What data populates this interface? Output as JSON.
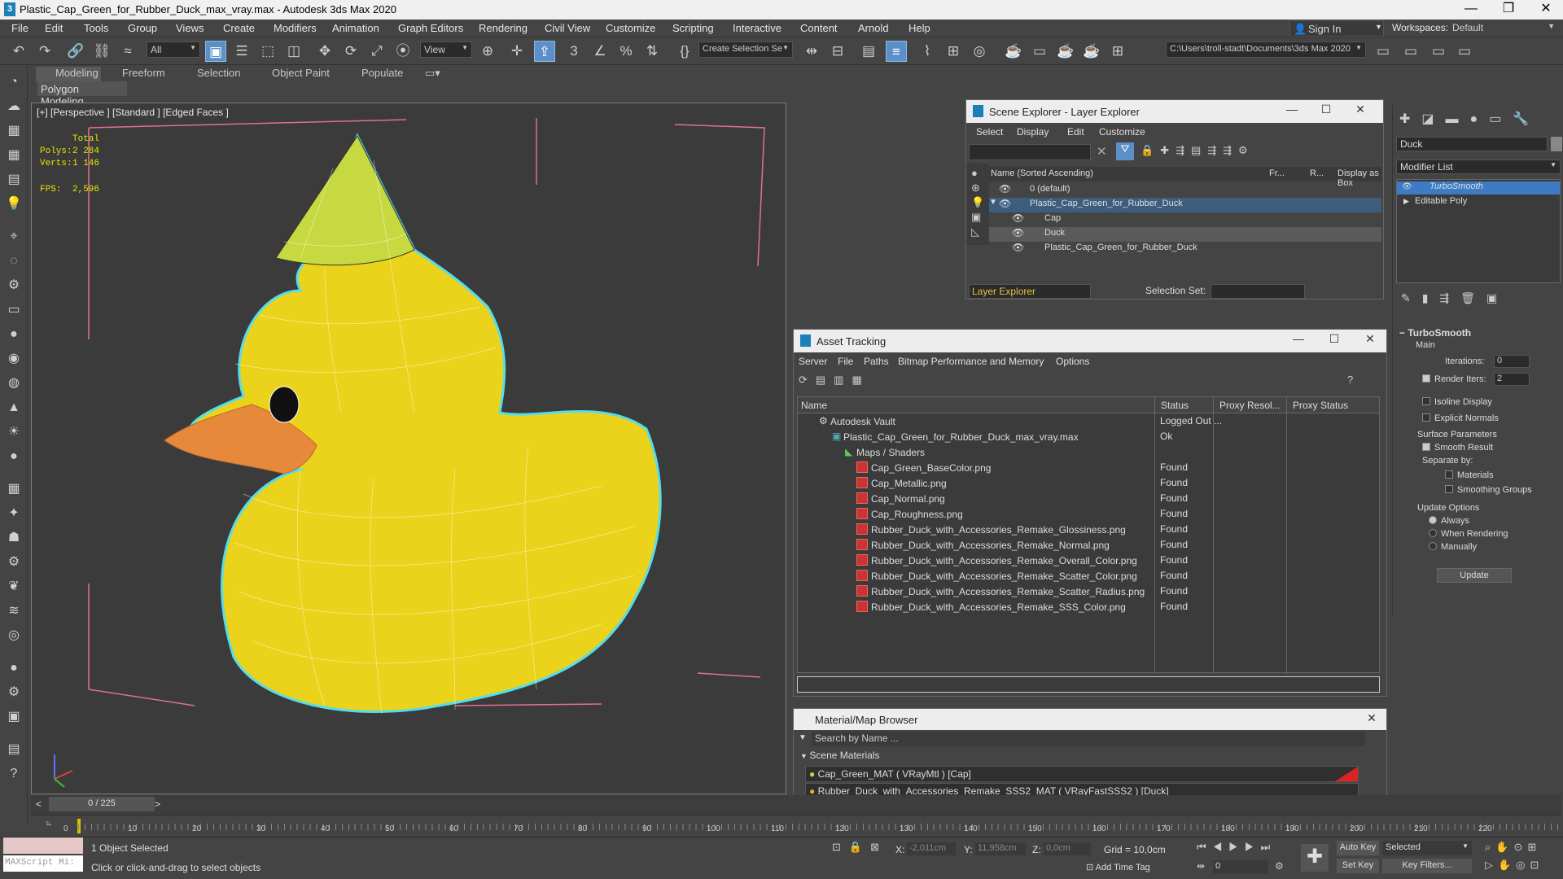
{
  "window": {
    "title": "Plastic_Cap_Green_for_Rubber_Duck_max_vray.max - Autodesk 3ds Max 2020"
  },
  "menu": [
    "File",
    "Edit",
    "Tools",
    "Group",
    "Views",
    "Create",
    "Modifiers",
    "Animation",
    "Graph Editors",
    "Rendering",
    "Civil View",
    "Customize",
    "Scripting",
    "Interactive",
    "Content",
    "Arnold",
    "Help"
  ],
  "account": {
    "signin": "Sign In",
    "workspaces_label": "Workspaces:",
    "workspace": "Default"
  },
  "toolbar": {
    "filter": "All",
    "view": "View",
    "selset": "Create Selection Se",
    "path": "C:\\Users\\troll-stadt\\Documents\\3ds Max 2020"
  },
  "ribbon": {
    "tabs": [
      "Modeling",
      "Freeform",
      "Selection",
      "Object Paint",
      "Populate"
    ],
    "sub": "Polygon Modeling"
  },
  "viewport": {
    "label": "[+] [Perspective ] [Standard ] [Edged Faces ]",
    "total": "Total",
    "polys_label": "Polys:",
    "polys": "2 284",
    "verts_label": "Verts:",
    "verts": "1 146",
    "fps_label": "FPS:",
    "fps": "2,596"
  },
  "scene_explorer": {
    "title": "Scene Explorer - Layer Explorer",
    "menu": [
      "Select",
      "Display",
      "Edit",
      "Customize"
    ],
    "col_name": "Name (Sorted Ascending)",
    "col_fr": "Fr...",
    "col_r": "R...",
    "col_box": "Display as Box",
    "rows": [
      "0 (default)",
      "Plastic_Cap_Green_for_Rubber_Duck",
      "Cap",
      "Duck",
      "Plastic_Cap_Green_for_Rubber_Duck"
    ],
    "footer_dd": "Layer Explorer",
    "selset_label": "Selection Set:"
  },
  "asset_tracking": {
    "title": "Asset Tracking",
    "menu": [
      "Server",
      "File",
      "Paths",
      "Bitmap Performance and Memory",
      "Options"
    ],
    "cols": [
      "Name",
      "Status",
      "Proxy Resol...",
      "Proxy Status"
    ],
    "rows": [
      {
        "name": "Autodesk Vault",
        "status": "Logged Out ..."
      },
      {
        "name": "Plastic_Cap_Green_for_Rubber_Duck_max_vray.max",
        "status": "Ok"
      },
      {
        "name": "Maps / Shaders",
        "status": ""
      },
      {
        "name": "Cap_Green_BaseColor.png",
        "status": "Found"
      },
      {
        "name": "Cap_Metallic.png",
        "status": "Found"
      },
      {
        "name": "Cap_Normal.png",
        "status": "Found"
      },
      {
        "name": "Cap_Roughness.png",
        "status": "Found"
      },
      {
        "name": "Rubber_Duck_with_Accessories_Remake_Glossiness.png",
        "status": "Found"
      },
      {
        "name": "Rubber_Duck_with_Accessories_Remake_Normal.png",
        "status": "Found"
      },
      {
        "name": "Rubber_Duck_with_Accessories_Remake_Overall_Color.png",
        "status": "Found"
      },
      {
        "name": "Rubber_Duck_with_Accessories_Remake_Scatter_Color.png",
        "status": "Found"
      },
      {
        "name": "Rubber_Duck_with_Accessories_Remake_Scatter_Radius.png",
        "status": "Found"
      },
      {
        "name": "Rubber_Duck_with_Accessories_Remake_SSS_Color.png",
        "status": "Found"
      }
    ]
  },
  "material_browser": {
    "title": "Material/Map Browser",
    "search": "Search by Name ...",
    "section": "Scene Materials",
    "items": [
      "Cap_Green_MAT  ( VRayMtl )  [Cap]",
      "Rubber_Duck_with_Accessories_Remake_SSS2_MAT  ( VRayFastSSS2 )  [Duck]"
    ]
  },
  "command_panel": {
    "object_name": "Duck",
    "modifier_list": "Modifier List",
    "stack": [
      "TurboSmooth",
      "Editable Poly"
    ],
    "rollout": "TurboSmooth",
    "main": "Main",
    "iterations_label": "Iterations:",
    "iterations": "0",
    "render_iters_label": "Render Iters:",
    "render_iters": "2",
    "isoline": "Isoline Display",
    "explicit": "Explicit Normals",
    "surface": "Surface Parameters",
    "smooth": "Smooth Result",
    "separate": "Separate by:",
    "materials": "Materials",
    "smoothing": "Smoothing Groups",
    "update_opts": "Update Options",
    "always": "Always",
    "when_render": "When Rendering",
    "manually": "Manually",
    "update_btn": "Update"
  },
  "timeline": {
    "frame": "0 / 225",
    "ticks": [
      "0",
      "10",
      "20",
      "30",
      "40",
      "50",
      "60",
      "70",
      "80",
      "90",
      "100",
      "110",
      "120",
      "130",
      "140",
      "150",
      "160",
      "170",
      "180",
      "190",
      "200",
      "210",
      "220"
    ]
  },
  "status": {
    "maxscript": "MAXScript Mi:",
    "selected": "1 Object Selected",
    "prompt": "Click or click-and-drag to select objects",
    "x_label": "X:",
    "x": "-2,011cm",
    "y_label": "Y:",
    "y": "11,958cm",
    "z_label": "Z:",
    "z": "0,0cm",
    "grid": "Grid = 10,0cm",
    "add_time_tag": "Add Time Tag",
    "autokey": "Auto Key",
    "setkey": "Set Key",
    "selected_dd": "Selected",
    "keyfilters": "Key Filters...",
    "frame_field": "0"
  }
}
